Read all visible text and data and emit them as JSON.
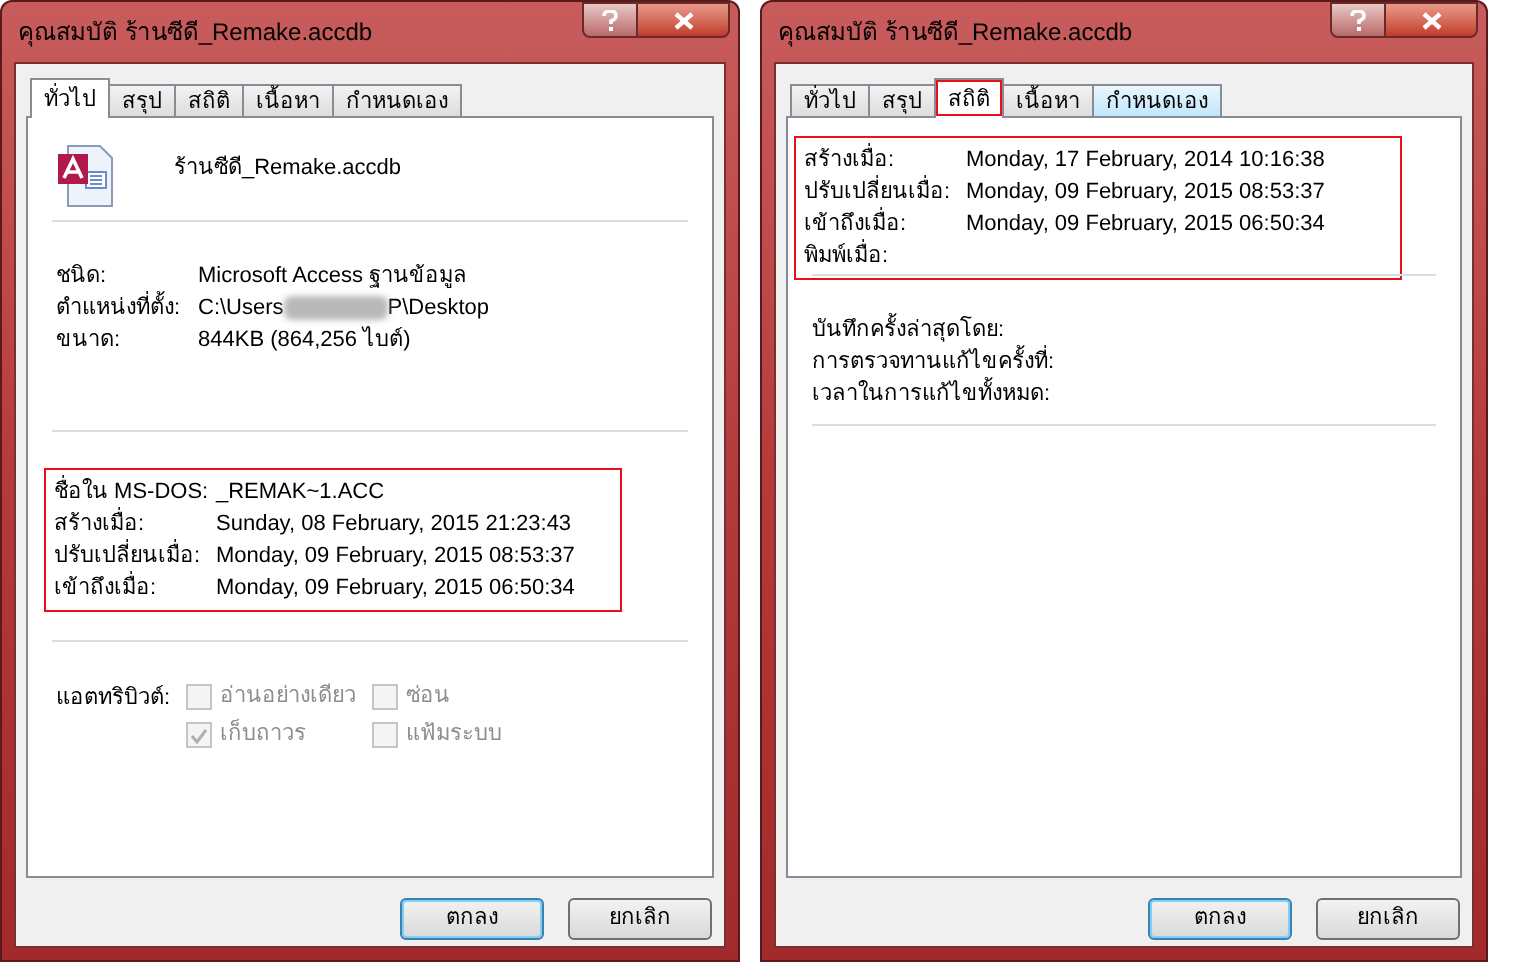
{
  "windows": [
    {
      "kind": "general",
      "title": "คุณสมบัติ ร้านซีดี_Remake.accdb",
      "tabs": [
        {
          "label": "ทั่วไป",
          "selected": true,
          "highlighted": false,
          "hovered": false
        },
        {
          "label": "สรุป",
          "selected": false,
          "highlighted": false,
          "hovered": false
        },
        {
          "label": "สถิติ",
          "selected": false,
          "highlighted": false,
          "hovered": false
        },
        {
          "label": "เนื้อหา",
          "selected": false,
          "highlighted": false,
          "hovered": false
        },
        {
          "label": "กำหนดเอง",
          "selected": false,
          "highlighted": false,
          "hovered": false
        }
      ],
      "file_name": "ร้านซีดี_Remake.accdb",
      "details": [
        {
          "label": "ชนิด:",
          "value": "Microsoft Access ฐานข้อมูล",
          "redacted": false
        },
        {
          "label": "ตำแหน่งที่ตั้ง:",
          "value": "C:\\Users",
          "redacted": true,
          "value_end": "P\\Desktop"
        },
        {
          "label": "ขนาด:",
          "value": "844KB (864,256 ไบต์)",
          "redacted": false
        }
      ],
      "dates": {
        "highlighted": true,
        "rows": [
          {
            "label": "ชื่อใน MS-DOS:",
            "value": "_REMAK~1.ACC"
          },
          {
            "label": "สร้างเมื่อ:",
            "value": "Sunday, 08 February, 2015 21:23:43"
          },
          {
            "label": "ปรับเปลี่ยนเมื่อ:",
            "value": "Monday, 09 February, 2015 08:53:37"
          },
          {
            "label": "เข้าถึงเมื่อ:",
            "value": "Monday, 09 February, 2015 06:50:34"
          }
        ]
      },
      "attributes": {
        "label": "แอตทริบิวต์:",
        "items": [
          {
            "label": "อ่านอย่างเดียว",
            "checked": false,
            "disabled": true
          },
          {
            "label": "ซ่อน",
            "checked": false,
            "disabled": true
          },
          {
            "label": "เก็บถาวร",
            "checked": true,
            "disabled": true
          },
          {
            "label": "แฟ้มระบบ",
            "checked": false,
            "disabled": true
          }
        ]
      },
      "buttons": [
        {
          "label": "ตกลง",
          "default": true
        },
        {
          "label": "ยกเลิก",
          "default": false
        }
      ]
    },
    {
      "kind": "statistics",
      "title": "คุณสมบัติ ร้านซีดี_Remake.accdb",
      "tabs": [
        {
          "label": "ทั่วไป",
          "selected": false,
          "highlighted": false,
          "hovered": false
        },
        {
          "label": "สรุป",
          "selected": false,
          "highlighted": false,
          "hovered": false
        },
        {
          "label": "สถิติ",
          "selected": true,
          "highlighted": true,
          "hovered": false
        },
        {
          "label": "เนื้อหา",
          "selected": false,
          "highlighted": false,
          "hovered": false
        },
        {
          "label": "กำหนดเอง",
          "selected": false,
          "highlighted": false,
          "hovered": true
        }
      ],
      "dates": {
        "highlighted": true,
        "rows": [
          {
            "label": "สร้างเมื่อ:",
            "value": "Monday, 17 February, 2014 10:16:38"
          },
          {
            "label": "ปรับเปลี่ยนเมื่อ:",
            "value": "Monday, 09 February, 2015 08:53:37"
          },
          {
            "label": "เข้าถึงเมื่อ:",
            "value": "Monday, 09 February, 2015 06:50:34"
          },
          {
            "label": "พิมพ์เมื่อ:"
          }
        ]
      },
      "info": [
        {
          "label": "บันทึกครั้งล่าสุดโดย:"
        },
        {
          "label": "การตรวจทานแก้ไขครั้งที่:"
        },
        {
          "label": "เวลาในการแก้ไขทั้งหมด:"
        }
      ],
      "buttons": [
        {
          "label": "ตกลง",
          "default": true
        },
        {
          "label": "ยกเลิก",
          "default": false
        }
      ]
    }
  ]
}
